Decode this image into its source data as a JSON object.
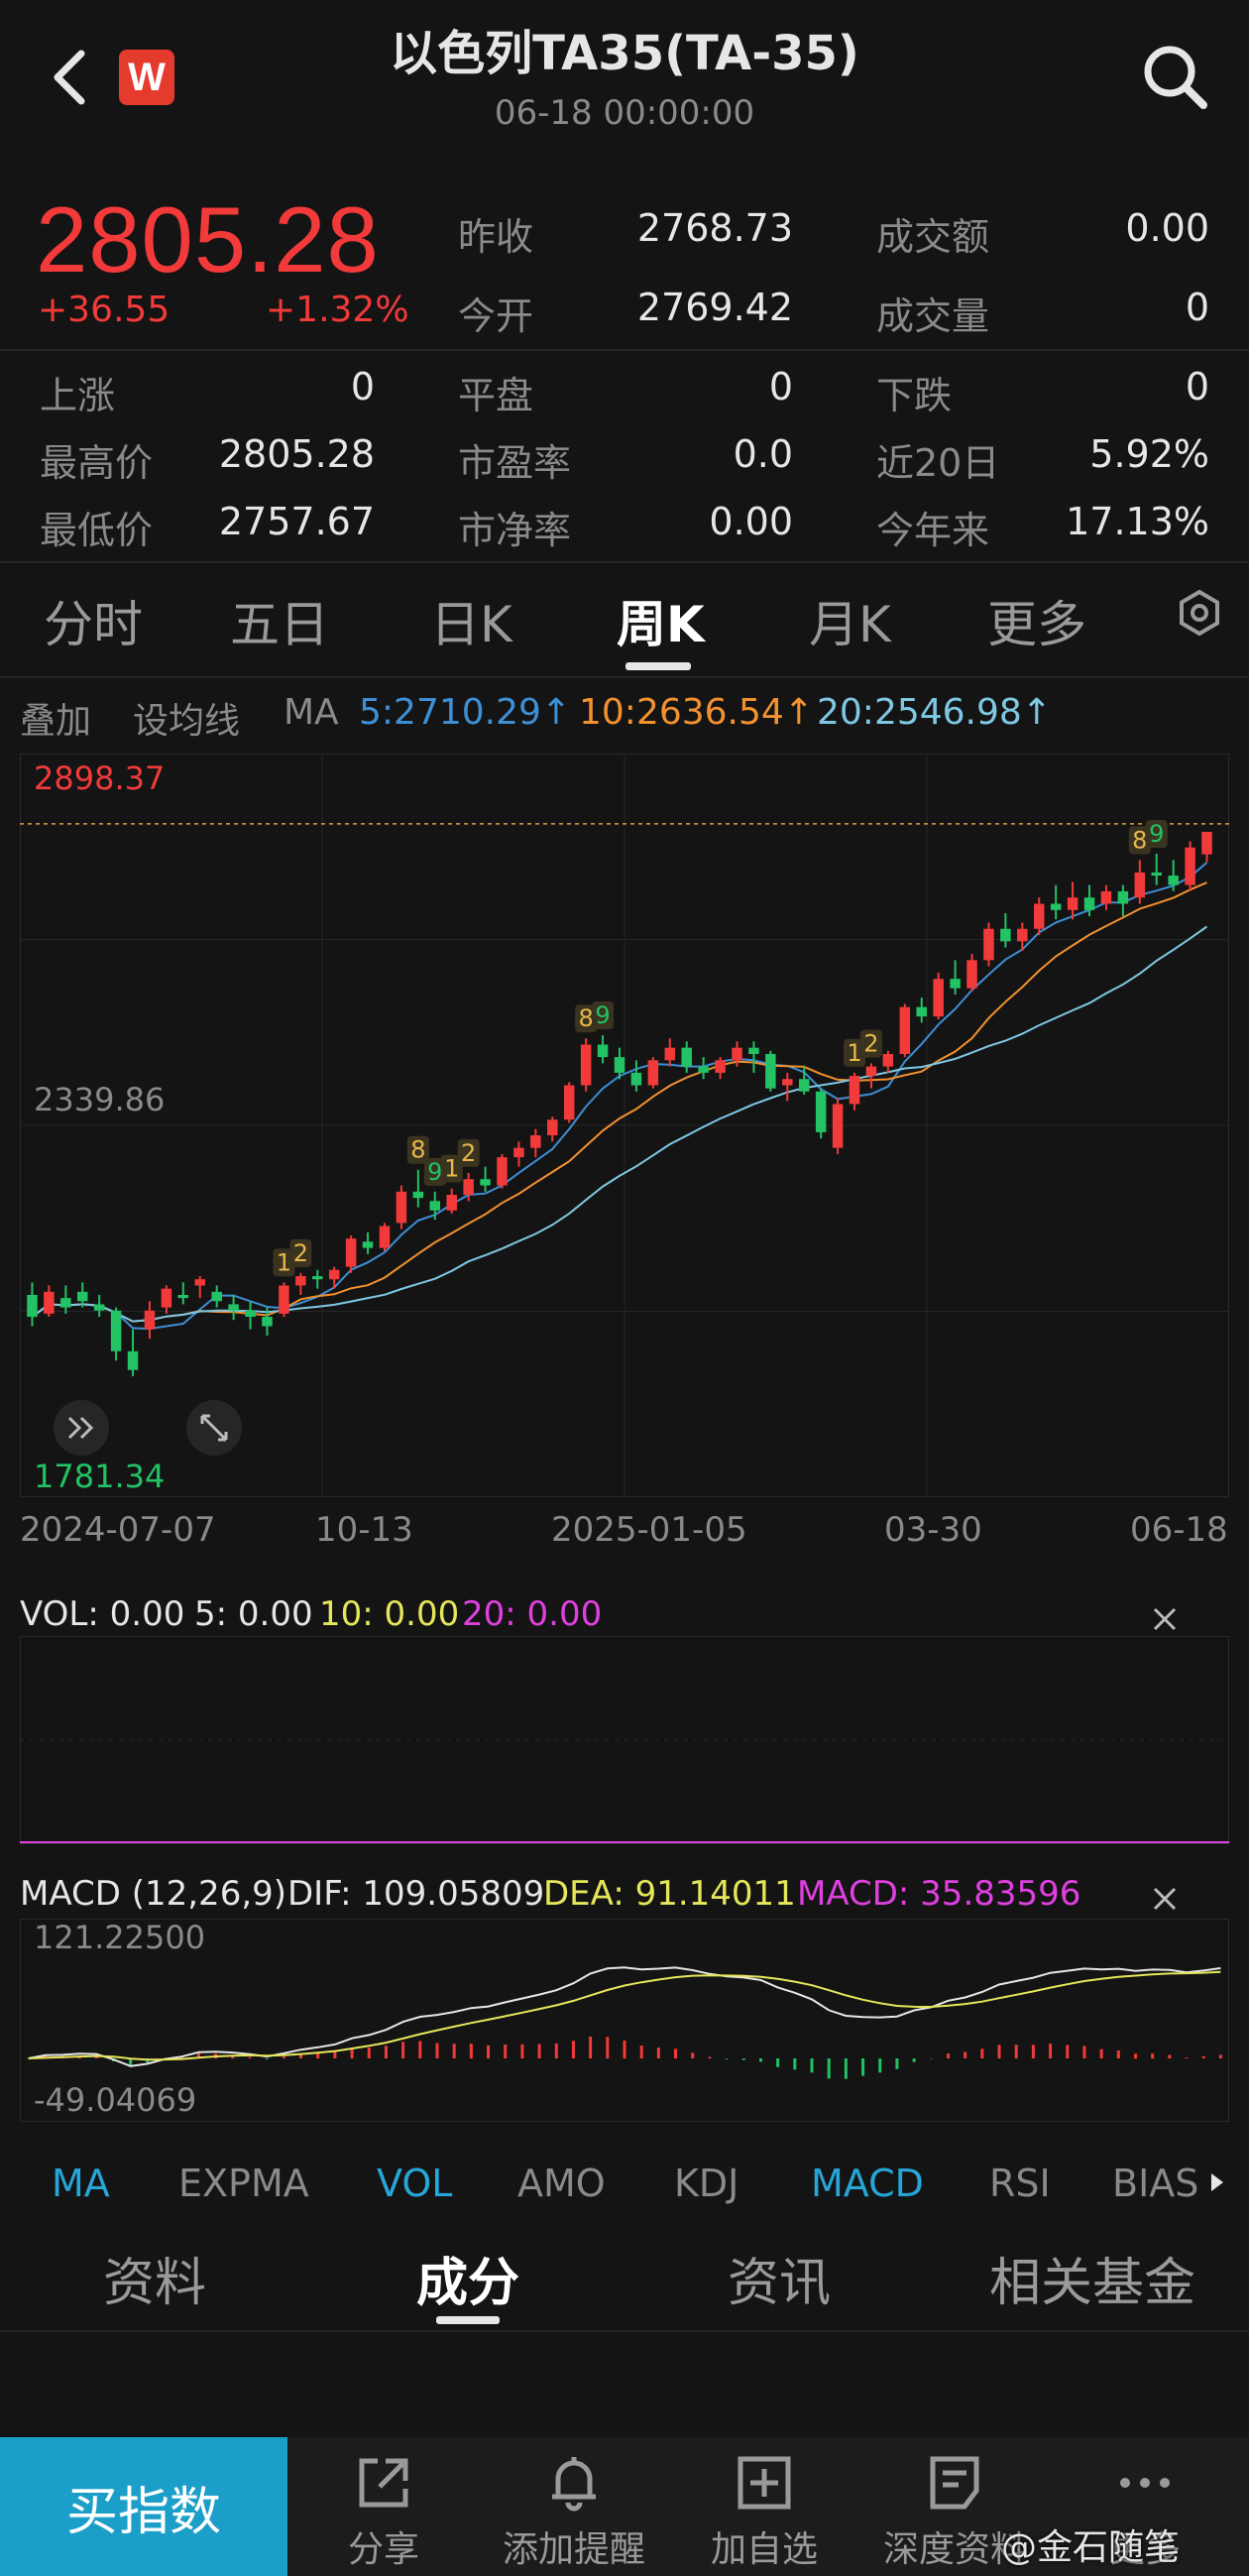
{
  "header": {
    "title": "以色列TA35(TA-35)",
    "datetime": "06-18 00:00:00",
    "logo_letter": "W"
  },
  "quote": {
    "price": "2805.28",
    "change": "+36.55",
    "change_pct": "+1.32%",
    "rows": [
      [
        {
          "label": "昨收",
          "value": "2768.73"
        },
        {
          "label": "成交额",
          "value": "0.00"
        }
      ],
      [
        {
          "label": "今开",
          "value": "2769.42"
        },
        {
          "label": "成交量",
          "value": "0"
        }
      ]
    ]
  },
  "stats": {
    "rows": [
      [
        {
          "label": "上涨",
          "value": "0"
        },
        {
          "label": "平盘",
          "value": "0"
        },
        {
          "label": "下跌",
          "value": "0"
        }
      ],
      [
        {
          "label": "最高价",
          "value": "2805.28"
        },
        {
          "label": "市盈率",
          "value": "0.0"
        },
        {
          "label": "近20日",
          "value": "5.92%"
        }
      ],
      [
        {
          "label": "最低价",
          "value": "2757.67"
        },
        {
          "label": "市净率",
          "value": "0.00"
        },
        {
          "label": "今年来",
          "value": "17.13%"
        }
      ]
    ]
  },
  "period_tabs": [
    "分时",
    "五日",
    "日K",
    "周K",
    "月K",
    "更多"
  ],
  "active_period": "周K",
  "ma_bar": {
    "overlay": "叠加",
    "set_ma": "设均线",
    "ma": "MA",
    "ma5": "5:2710.29↑",
    "ma10": "10:2636.54↑",
    "ma20": "20:2546.98↑"
  },
  "colors": {
    "up": "#f23a3a",
    "down": "#22c265",
    "ma5": "#3d8fd6",
    "ma10": "#f2912f",
    "ma20": "#7ec8e3",
    "dif": "#e6e6e6",
    "dea": "#e6e65a",
    "macd": "#e040e0"
  },
  "chart_data": [
    {
      "type": "candlestick",
      "period": "weekly",
      "y_max_label": "2898.37",
      "y_mid_label": "2339.86",
      "y_min_label": "1781.34",
      "ylim": [
        1781.34,
        2898.37
      ],
      "x_tick_labels": [
        "2024-07-07",
        "10-13",
        "2025-01-05",
        "03-30",
        "06-18"
      ],
      "ohlc": [
        [
          2065,
          2085,
          2015,
          2030
        ],
        [
          2035,
          2080,
          2030,
          2070
        ],
        [
          2060,
          2080,
          2035,
          2045
        ],
        [
          2070,
          2085,
          2045,
          2055
        ],
        [
          2050,
          2065,
          2030,
          2040
        ],
        [
          2040,
          2045,
          1960,
          1975
        ],
        [
          1975,
          2010,
          1935,
          1945
        ],
        [
          2010,
          2055,
          1995,
          2040
        ],
        [
          2045,
          2080,
          2035,
          2075
        ],
        [
          2065,
          2085,
          2050,
          2060
        ],
        [
          2080,
          2095,
          2060,
          2090
        ],
        [
          2070,
          2080,
          2045,
          2055
        ],
        [
          2050,
          2065,
          2025,
          2040
        ],
        [
          2040,
          2055,
          2010,
          2030
        ],
        [
          2030,
          2045,
          2000,
          2015
        ],
        [
          2035,
          2085,
          2030,
          2080
        ],
        [
          2080,
          2100,
          2065,
          2095
        ],
        [
          2095,
          2105,
          2075,
          2090
        ],
        [
          2090,
          2110,
          2075,
          2105
        ],
        [
          2110,
          2160,
          2100,
          2155
        ],
        [
          2150,
          2165,
          2130,
          2140
        ],
        [
          2140,
          2180,
          2135,
          2175
        ],
        [
          2180,
          2240,
          2170,
          2230
        ],
        [
          2230,
          2265,
          2205,
          2220
        ],
        [
          2215,
          2230,
          2185,
          2200
        ],
        [
          2200,
          2235,
          2195,
          2225
        ],
        [
          2225,
          2260,
          2215,
          2250
        ],
        [
          2250,
          2270,
          2230,
          2240
        ],
        [
          2240,
          2290,
          2235,
          2285
        ],
        [
          2285,
          2310,
          2270,
          2300
        ],
        [
          2300,
          2330,
          2285,
          2320
        ],
        [
          2320,
          2350,
          2310,
          2345
        ],
        [
          2345,
          2405,
          2340,
          2400
        ],
        [
          2400,
          2475,
          2390,
          2465
        ],
        [
          2465,
          2480,
          2435,
          2445
        ],
        [
          2445,
          2460,
          2410,
          2420
        ],
        [
          2420,
          2440,
          2390,
          2400
        ],
        [
          2400,
          2445,
          2395,
          2440
        ],
        [
          2440,
          2475,
          2430,
          2460
        ],
        [
          2460,
          2470,
          2420,
          2430
        ],
        [
          2430,
          2445,
          2410,
          2420
        ],
        [
          2420,
          2445,
          2410,
          2440
        ],
        [
          2440,
          2470,
          2430,
          2460
        ],
        [
          2460,
          2470,
          2420,
          2450
        ],
        [
          2450,
          2455,
          2390,
          2395
        ],
        [
          2400,
          2420,
          2375,
          2410
        ],
        [
          2410,
          2430,
          2385,
          2390
        ],
        [
          2390,
          2395,
          2315,
          2325
        ],
        [
          2300,
          2380,
          2290,
          2370
        ],
        [
          2370,
          2420,
          2360,
          2415
        ],
        [
          2415,
          2435,
          2395,
          2430
        ],
        [
          2430,
          2455,
          2420,
          2450
        ],
        [
          2450,
          2530,
          2445,
          2525
        ],
        [
          2525,
          2540,
          2500,
          2510
        ],
        [
          2510,
          2580,
          2505,
          2570
        ],
        [
          2570,
          2600,
          2545,
          2555
        ],
        [
          2555,
          2610,
          2550,
          2600
        ],
        [
          2600,
          2660,
          2590,
          2650
        ],
        [
          2650,
          2675,
          2620,
          2630
        ],
        [
          2630,
          2660,
          2615,
          2650
        ],
        [
          2650,
          2700,
          2640,
          2690
        ],
        [
          2690,
          2720,
          2665,
          2680
        ],
        [
          2680,
          2725,
          2665,
          2700
        ],
        [
          2700,
          2720,
          2670,
          2680
        ],
        [
          2690,
          2720,
          2680,
          2710
        ],
        [
          2710,
          2720,
          2670,
          2690
        ],
        [
          2700,
          2760,
          2690,
          2740
        ],
        [
          2740,
          2770,
          2720,
          2735
        ],
        [
          2735,
          2760,
          2710,
          2720
        ],
        [
          2720,
          2790,
          2710,
          2780
        ],
        [
          2769,
          2805,
          2757,
          2805
        ]
      ],
      "sequence_labels": [
        {
          "index": 15,
          "text": "1",
          "color": "up"
        },
        {
          "index": 16,
          "text": "2",
          "color": "up"
        },
        {
          "index": 23,
          "text": "8",
          "color": "up"
        },
        {
          "index": 24,
          "text": "9",
          "color": "down"
        },
        {
          "index": 25,
          "text": "1",
          "color": "up"
        },
        {
          "index": 26,
          "text": "2",
          "color": "up"
        },
        {
          "index": 33,
          "text": "8",
          "color": "up"
        },
        {
          "index": 34,
          "text": "9",
          "color": "down"
        },
        {
          "index": 49,
          "text": "1",
          "color": "up"
        },
        {
          "index": 50,
          "text": "2",
          "color": "up"
        },
        {
          "index": 66,
          "text": "8",
          "color": "up"
        },
        {
          "index": 67,
          "text": "9",
          "color": "down"
        }
      ]
    },
    {
      "type": "bar",
      "name": "VOL",
      "values": {
        "VOL": "0.00",
        "5": "0.00",
        "10": "0.00",
        "20": "0.00"
      }
    },
    {
      "type": "line",
      "name": "MACD",
      "params": "MACD (12,26,9)",
      "DIF": "109.05809",
      "DEA": "91.14011",
      "MACD": "35.83596",
      "y_max_label": "121.22500",
      "y_min_label": "-49.04069",
      "ylim": [
        -49.04069,
        121.225
      ]
    }
  ],
  "vol_bar": {
    "vol": "VOL: 0.00",
    "v5": "5: 0.00",
    "v10": "10: 0.00",
    "v20": "20: 0.00"
  },
  "macd_bar": {
    "params": "MACD (12,26,9)",
    "dif": "DIF: 109.05809",
    "dea": "DEA: 91.14011",
    "macd": "MACD: 35.83596",
    "y_top": "121.22500",
    "y_bottom": "-49.04069"
  },
  "indicators": [
    "MA",
    "EXPMA",
    "VOL",
    "AMO",
    "KDJ",
    "MACD",
    "RSI",
    "BIAS"
  ],
  "indicators_on": [
    "MA",
    "VOL",
    "MACD"
  ],
  "info_tabs": [
    "资料",
    "成分",
    "资讯",
    "相关基金"
  ],
  "active_info_tab": "成分",
  "bottom_bar": {
    "buy": "买指数",
    "items": [
      "分享",
      "添加提醒",
      "加自选",
      "深度资料",
      "更多"
    ]
  },
  "watermark": "@金石随笔"
}
